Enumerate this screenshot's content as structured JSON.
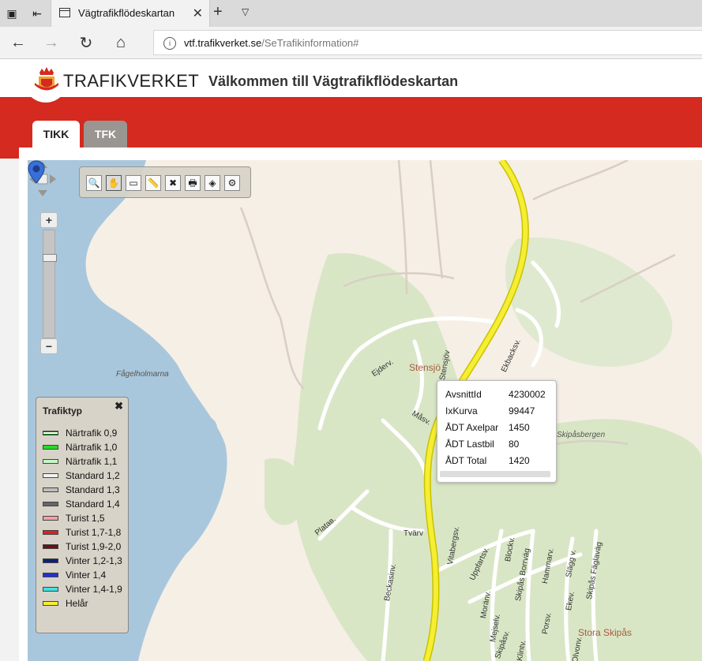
{
  "browser": {
    "tab_title": "Vägtrafikflödeskartan",
    "tab_close": "✕",
    "new_tab": "+",
    "tab_menu": "⌄",
    "url_host": "vtf.trafikverket.se",
    "url_path": "/SeTrafikinformation#"
  },
  "site": {
    "logo_text": "TRAFIKVERKET",
    "title": "Välkommen till Vägtrafikflödeskartan",
    "tabs": [
      {
        "label": "TIKK",
        "active": true
      },
      {
        "label": "TFK",
        "active": false
      }
    ]
  },
  "map": {
    "zoom_in": "+",
    "zoom_out": "−",
    "tools": [
      {
        "name": "zoom-tool",
        "glyph": "🔍"
      },
      {
        "name": "pan-tool",
        "glyph": "✋"
      },
      {
        "name": "scale-tool",
        "glyph": "▭"
      },
      {
        "name": "measure-tool",
        "glyph": "📏"
      },
      {
        "name": "clear-tool",
        "glyph": "✖"
      },
      {
        "name": "print-tool",
        "glyph": "🖶"
      },
      {
        "name": "layers-tool",
        "glyph": "◈"
      },
      {
        "name": "settings-tool",
        "glyph": "⚙"
      }
    ],
    "labels": {
      "fagelholmarna": "Fågelholmarna",
      "stensjo": "Stensjö",
      "skipasbergen": "Skipåsbergen",
      "stora_skipas": "Stora Skipås"
    },
    "streets": {
      "ejderv": "Ejderv.",
      "masv": "Måsv.",
      "ekbacksv": "Ekbacksv.",
      "platav": "Plataв.",
      "tvarv": "Tvärv",
      "vitabergsv": "Vitabergsv.",
      "beckasinv": "Beckasinv.",
      "uppfartsv": "Uppfartsv.",
      "blockv": "Blockv.",
      "skipas_borrvag": "Skipås Borrväg",
      "hammarv": "Hammarv.",
      "slaggv": "Slägg v.",
      "skipas_faglavag": "Skipås Fäglaväg",
      "moranv": "Moränv.",
      "mejselv": "Mejselv.",
      "porsv": "Porsv.",
      "ekev": "Ekev.",
      "skipasv": "Skipåsv.",
      "klintv": "Klintv.",
      "olvonv": "Olvonv.",
      "stensjov": "Stensjöv"
    }
  },
  "legend": {
    "title": "Trafiktyp",
    "close": "✖",
    "items": [
      {
        "label": "Närtrafik 0,9",
        "color": "#1a7a1a",
        "inner": "#ffffff"
      },
      {
        "label": "Närtrafik 1,0",
        "color": "#22dd22",
        "inner": "#22dd22"
      },
      {
        "label": "Närtrafik 1,1",
        "color": "#c6f5c6",
        "inner": "#c6f5c6"
      },
      {
        "label": "Standard 1,2",
        "color": "#f2f2f2",
        "inner": "#f2f2f2"
      },
      {
        "label": "Standard 1,3",
        "color": "#bdbdbd",
        "inner": "#bdbdbd"
      },
      {
        "label": "Standard 1,4",
        "color": "#666666",
        "inner": "#666666"
      },
      {
        "label": "Turist 1,5",
        "color": "#f2a2a2",
        "inner": "#f2a2a2"
      },
      {
        "label": "Turist 1,7-1,8",
        "color": "#dd2222",
        "inner": "#dd2222"
      },
      {
        "label": "Turist 1,9-2,0",
        "color": "#6a1010",
        "inner": "#6a1010"
      },
      {
        "label": "Vinter 1,2-1,3",
        "color": "#102070",
        "inner": "#102070"
      },
      {
        "label": "Vinter 1,4",
        "color": "#2233cc",
        "inner": "#2233cc"
      },
      {
        "label": "Vinter 1,4-1,9",
        "color": "#44e0e0",
        "inner": "#44e0e0"
      },
      {
        "label": "Helår",
        "color": "#f5ee33",
        "inner": "#f5ee33"
      }
    ]
  },
  "popup": {
    "rows": [
      {
        "key": "AvsnittId",
        "value": "4230002"
      },
      {
        "key": "IxKurva",
        "value": "99447"
      },
      {
        "key": "ÅDT Axelpar",
        "value": "1450"
      },
      {
        "key": "ÅDT Lastbil",
        "value": "80"
      },
      {
        "key": "ÅDT Total",
        "value": "1420"
      }
    ]
  },
  "colors": {
    "brand_red": "#d42a20",
    "water": "#a9c7dc",
    "land": "#f6efe6",
    "forest": "#d9e6c6",
    "road_highlight": "#f5ee33"
  }
}
